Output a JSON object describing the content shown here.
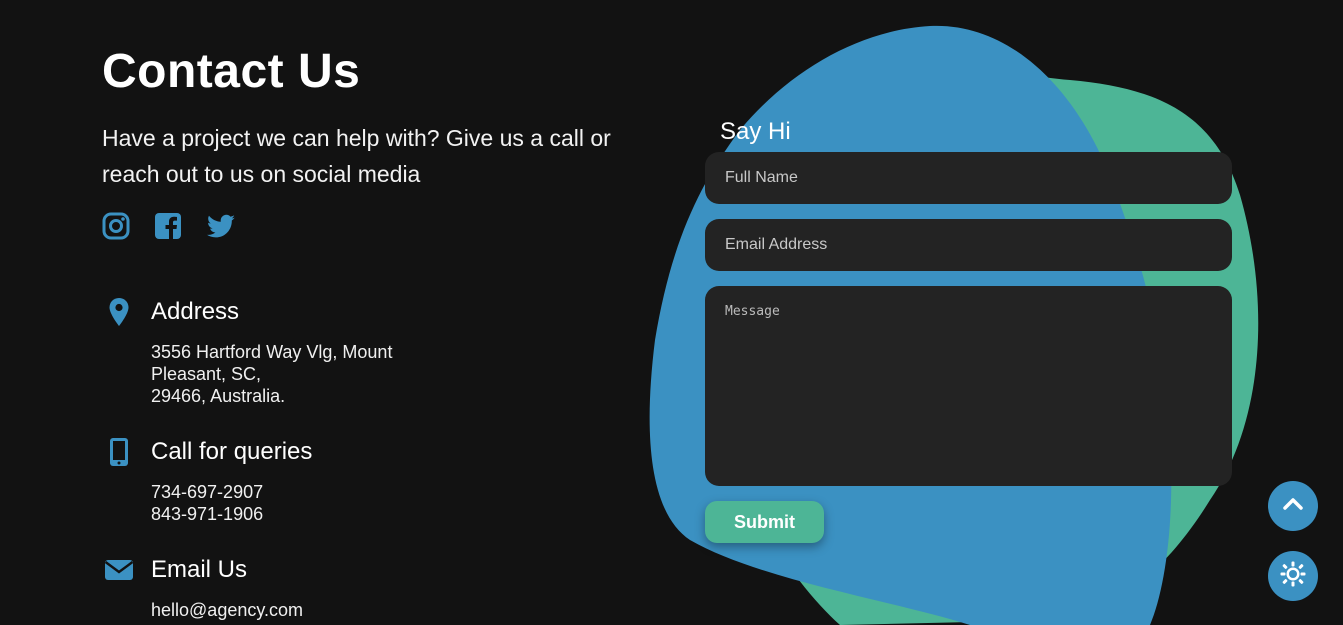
{
  "header": {
    "title": "Contact Us",
    "intro": "Have a project we can help with? Give us a call or reach out to us on social media"
  },
  "social": [
    {
      "icon": "instagram-icon"
    },
    {
      "icon": "facebook-icon"
    },
    {
      "icon": "twitter-icon"
    }
  ],
  "contact": {
    "address": {
      "icon": "location-pin-icon",
      "label": "Address",
      "lines": [
        "3556 Hartford Way Vlg, Mount",
        "Pleasant, SC,",
        "29466, Australia."
      ]
    },
    "phone": {
      "icon": "mobile-phone-icon",
      "label": "Call for queries",
      "lines": [
        "734-697-2907",
        "843-971-1906"
      ]
    },
    "email": {
      "icon": "envelope-icon",
      "label": "Email Us",
      "lines": [
        "hello@agency.com"
      ]
    }
  },
  "form": {
    "heading": "Say Hi",
    "name_placeholder": "Full Name",
    "email_placeholder": "Email Address",
    "message_placeholder": "Message",
    "submit_label": "Submit"
  },
  "fabs": {
    "top_icon": "chevron-up-icon",
    "theme_icon": "sun-icon"
  },
  "colors": {
    "background": "#121212",
    "accent_blue": "#3b91c2",
    "accent_green": "#4db596",
    "field_bg": "#232323"
  }
}
